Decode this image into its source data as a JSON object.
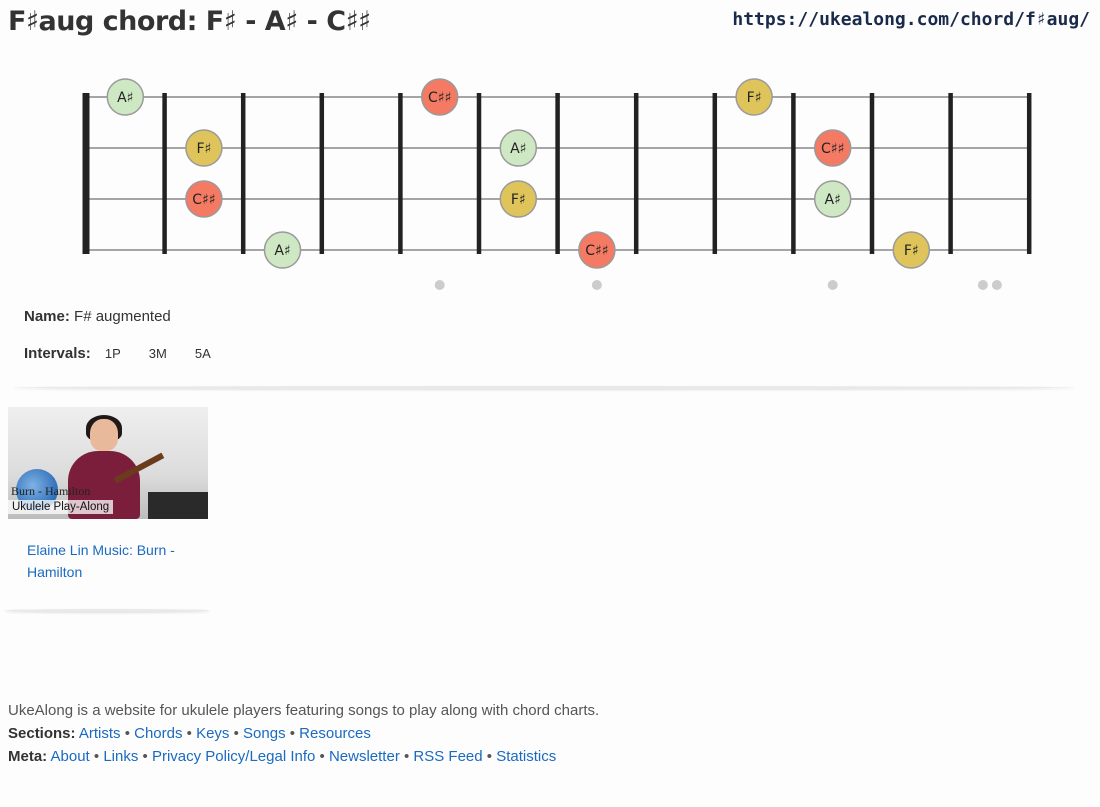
{
  "page": {
    "title": "F♯aug chord: F♯ - A♯ - C♯♯",
    "url": "https://ukealong.com/chord/f♯aug/"
  },
  "fretboard": {
    "strings": 4,
    "frets": 12,
    "colors": {
      "root": "#dfc45c",
      "third": "#cfe8c4",
      "fifth": "#f47a64"
    },
    "notes": [
      {
        "string": 1,
        "fret": 1,
        "label": "A♯",
        "role": "third"
      },
      {
        "string": 1,
        "fret": 5,
        "label": "C♯♯",
        "role": "fifth"
      },
      {
        "string": 1,
        "fret": 9,
        "label": "F♯",
        "role": "root"
      },
      {
        "string": 2,
        "fret": 2,
        "label": "F♯",
        "role": "root"
      },
      {
        "string": 2,
        "fret": 6,
        "label": "A♯",
        "role": "third"
      },
      {
        "string": 2,
        "fret": 10,
        "label": "C♯♯",
        "role": "fifth"
      },
      {
        "string": 3,
        "fret": 2,
        "label": "C♯♯",
        "role": "fifth"
      },
      {
        "string": 3,
        "fret": 6,
        "label": "F♯",
        "role": "root"
      },
      {
        "string": 3,
        "fret": 10,
        "label": "A♯",
        "role": "third"
      },
      {
        "string": 4,
        "fret": 3,
        "label": "A♯",
        "role": "third"
      },
      {
        "string": 4,
        "fret": 7,
        "label": "C♯♯",
        "role": "fifth"
      },
      {
        "string": 4,
        "fret": 11,
        "label": "F♯",
        "role": "root"
      }
    ],
    "marker_frets": [
      5,
      7,
      10,
      12
    ],
    "double_marker_fret": 12
  },
  "info": {
    "name_label": "Name:",
    "name_value": "F# augmented",
    "intervals_label": "Intervals:",
    "intervals": [
      "1P",
      "3M",
      "5A"
    ]
  },
  "video": {
    "caption_line1": "Burn - Hamilton",
    "caption_line2": "Ukulele Play-Along",
    "link": "Elaine Lin Music: Burn - Hamilton"
  },
  "footer": {
    "tagline": "UkeAlong is a website for ukulele players featuring songs to play along with chord charts.",
    "sections_label": "Sections:",
    "sections": [
      "Artists",
      "Chords",
      "Keys",
      "Songs",
      "Resources"
    ],
    "meta_label": "Meta:",
    "meta": [
      "About",
      "Links",
      "Privacy Policy/Legal Info",
      "Newsletter",
      "RSS Feed",
      "Statistics"
    ]
  }
}
